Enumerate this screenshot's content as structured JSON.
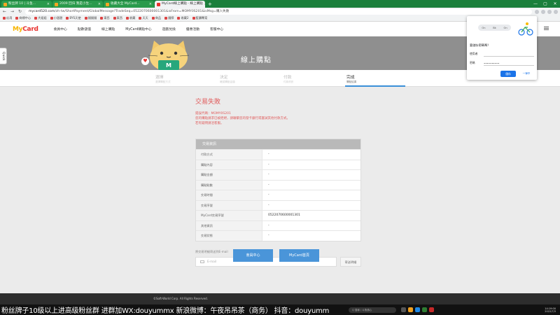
{
  "browser": {
    "tabs": [
      {
        "label": "粉丝牌 10 | 斗鱼...",
        "active": false
      },
      {
        "label": "2009 回归 我是小生...",
        "active": false
      },
      {
        "label": "收藏大全 MyCard...",
        "active": false
      },
      {
        "label": "MyCard線上購點 - 線上購點",
        "active": true
      }
    ],
    "newtab": "+",
    "win_min": "—",
    "win_max": "▢",
    "win_close": "✕",
    "tab_close": "×",
    "nav": {
      "back": "←",
      "forward": "→",
      "reload": "↻"
    },
    "url_host": "mycard520.com",
    "url_path": "/zh-tw/ShortPayment/GlobalMessage?TradeSeq=0522070600001301&isFrom=MOMY0S201&isMsg=購入失敗",
    "bookmarks": [
      "応用",
      "商標中心",
      "大姐姐",
      "小甜甜",
      "BYS天使",
      "錢錢錢",
      "東西",
      "東西",
      "收藏",
      "天天",
      "商品",
      "國際",
      "收藏2",
      "藍鑽專案"
    ]
  },
  "site": {
    "logo_my": "My",
    "logo_card": "Card",
    "nav": [
      "會員中心",
      "點數儲值",
      "線上購點",
      "MyCard購點中心",
      "遊戲兌換",
      "優惠活動",
      "客服中心"
    ],
    "hero_title": "線上購點",
    "quick_label": "Quick",
    "heart": "♥",
    "cat_label": "M"
  },
  "steps": [
    {
      "title": "選擇",
      "sub": "選擇購點方式",
      "active": false
    },
    {
      "title": "決定",
      "sub": "確認購點金額",
      "active": false
    },
    {
      "title": "付款",
      "sub": "付款資訊",
      "active": false
    },
    {
      "title": "完成",
      "sub": "購點結果",
      "active": true
    }
  ],
  "result": {
    "title": "交易失敗",
    "lines": [
      "錯誤代碼：MOMY0S201",
      "您的購點請求已被拒絕，請聯繫您的發卡銀行或嘗試其他付款方式。",
      "若有疑問請洽客服。"
    ]
  },
  "details": {
    "header": "交易資訊",
    "rows": [
      {
        "k": "付款方式",
        "v": "-"
      },
      {
        "k": "購點內容",
        "v": "-"
      },
      {
        "k": "購點金額",
        "v": "-"
      },
      {
        "k": "購點點數",
        "v": "-"
      },
      {
        "k": "交易時間",
        "v": "-"
      },
      {
        "k": "交易序號",
        "v": "-"
      },
      {
        "k": "MyCard交易序號",
        "v": "0522070600001301"
      },
      {
        "k": "其他資訊",
        "v": "-"
      },
      {
        "k": "交易狀態",
        "v": "-"
      }
    ]
  },
  "email": {
    "label": "將交易明細寄送到E-mail",
    "placeholder": "E-mail",
    "send": "寄送明細"
  },
  "buttons": {
    "member": "會員中心",
    "home": "MyCard首頁"
  },
  "footer": "©Soft-World Corp. All Rights Reserved.",
  "popup": {
    "tab_left": "On",
    "tab_mid": "Bk",
    "tab_right": "On",
    "question": "要儲存密碼嗎？",
    "user_label": "使用者",
    "user_value": "",
    "pass_label": "密碼",
    "pass_value": "••••••••••",
    "save": "儲存",
    "never": "一律不"
  },
  "overlay": {
    "text": "粉丝牌子10级以上进高级粉丝群  进群加WX:douyummx 新浪微博：午夜吊吊茶（商务）  抖音：douyummx",
    "search": "Q 搜尋 / 斗魚佛心",
    "time": "14:19:00",
    "date": "2022/7/3"
  }
}
